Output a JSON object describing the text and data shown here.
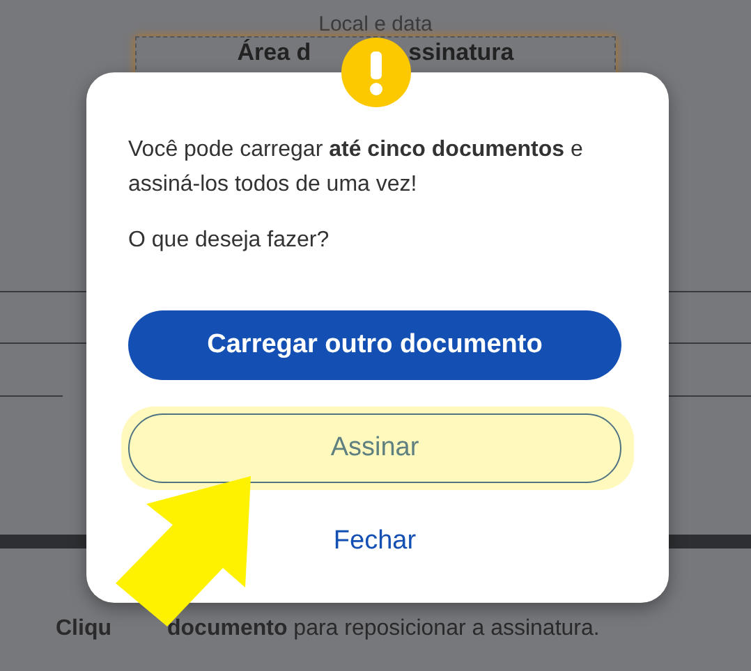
{
  "document": {
    "caption": "Local e data",
    "signature_area": [
      "Área d",
      "ssinatura"
    ],
    "hint_start": "Cliqu",
    "hint_rest": "**documento** para reposicionar a assinatura."
  },
  "dialog": {
    "message": "Você pode carregar **até cinco documentos** e assiná-los todos de uma vez!",
    "question": "O que deseja fazer?",
    "buttons": [
      {
        "label": "Carregar outro documento",
        "kind": "primary",
        "highlighted": false
      },
      {
        "label": "Assinar",
        "kind": "outline",
        "highlighted": true
      },
      {
        "label": "Fechar",
        "kind": "link",
        "highlighted": false
      }
    ]
  }
}
